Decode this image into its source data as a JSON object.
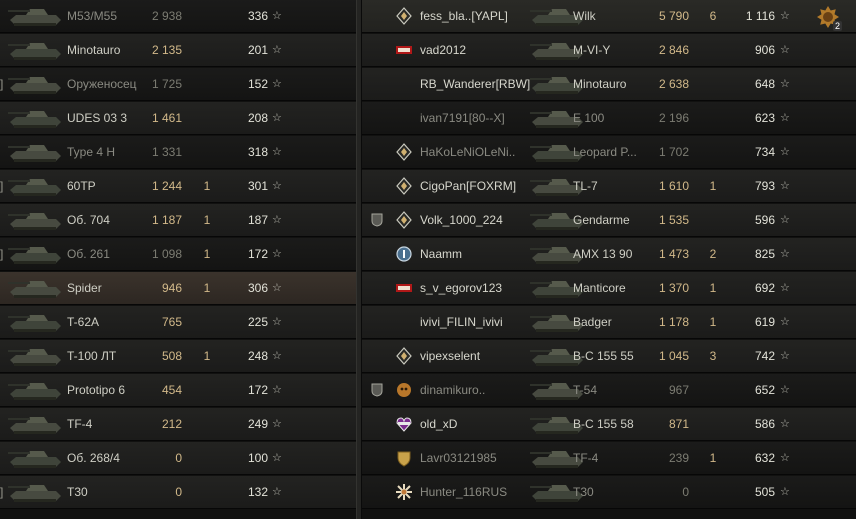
{
  "left_team": [
    {
      "clip": "",
      "tank": "M53/M55",
      "damage": "2 938",
      "frags": "",
      "xp": "336",
      "dead": true
    },
    {
      "clip": "",
      "tank": "Minotauro",
      "damage": "2 135",
      "frags": "",
      "xp": "201",
      "dead": false
    },
    {
      "clip": "]",
      "tank": "Оруженосец",
      "damage": "1 725",
      "frags": "",
      "xp": "152",
      "dead": true
    },
    {
      "clip": "",
      "tank": "UDES 03 3",
      "damage": "1 461",
      "frags": "",
      "xp": "208",
      "dead": false
    },
    {
      "clip": "",
      "tank": "Type 4 H",
      "damage": "1 331",
      "frags": "",
      "xp": "318",
      "dead": true
    },
    {
      "clip": "]",
      "tank": "60TP",
      "damage": "1 244",
      "frags": "1",
      "xp": "301",
      "dead": false
    },
    {
      "clip": "",
      "tank": "Об. 704",
      "damage": "1 187",
      "frags": "1",
      "xp": "187",
      "dead": false
    },
    {
      "clip": "]",
      "tank": "Об. 261",
      "damage": "1 098",
      "frags": "1",
      "xp": "172",
      "dead": true
    },
    {
      "clip": "",
      "tank": "Spider",
      "damage": "946",
      "frags": "1",
      "xp": "306",
      "dead": false,
      "self": true
    },
    {
      "clip": "",
      "tank": "T-62A",
      "damage": "765",
      "frags": "",
      "xp": "225",
      "dead": false
    },
    {
      "clip": "",
      "tank": "T-100 ЛТ",
      "damage": "508",
      "frags": "1",
      "xp": "248",
      "dead": false
    },
    {
      "clip": "",
      "tank": "Prototipo 6",
      "damage": "454",
      "frags": "",
      "xp": "172",
      "dead": false
    },
    {
      "clip": "",
      "tank": "TF-4",
      "damage": "212",
      "frags": "",
      "xp": "249",
      "dead": false
    },
    {
      "clip": "",
      "tank": "Об. 268/4",
      "damage": "0",
      "frags": "",
      "xp": "100",
      "dead": false
    },
    {
      "clip": "]",
      "tank": "T30",
      "damage": "0",
      "frags": "",
      "xp": "132",
      "dead": false
    }
  ],
  "right_team": [
    {
      "player": "fess_bla..[YAPL]",
      "badge": "rank-diamond-icon",
      "tank": "Wilk",
      "damage": "5 790",
      "frags": "6",
      "xp": "1 116",
      "dead": false,
      "platoon": false,
      "medal_count": "2"
    },
    {
      "player": "vad2012",
      "badge": "80-ribbon-icon",
      "tank": "M-VI-Y",
      "damage": "2 846",
      "frags": "",
      "xp": "906",
      "dead": false,
      "platoon": false
    },
    {
      "player": "RB_Wanderer[RBW]",
      "badge": "",
      "tank": "Minotauro",
      "damage": "2 638",
      "frags": "",
      "xp": "648",
      "dead": false,
      "platoon": false
    },
    {
      "player": "ivan7191[80--X]",
      "badge": "",
      "tank": "E 100",
      "damage": "2 196",
      "frags": "",
      "xp": "623",
      "dead": true,
      "platoon": false
    },
    {
      "player": "HaKoLeNiOLeNi..",
      "badge": "rank-diamond-icon",
      "tank": "Leopard P...",
      "damage": "1 702",
      "frags": "",
      "xp": "734",
      "dead": true,
      "platoon": false
    },
    {
      "player": "CigoPan[FOXRM]",
      "badge": "rank-diamond-icon",
      "tank": "TL-7",
      "damage": "1 610",
      "frags": "1",
      "xp": "793",
      "dead": false,
      "platoon": false
    },
    {
      "player": "Volk_1000_224",
      "badge": "rank-diamond-icon",
      "tank": "Gendarme",
      "damage": "1 535",
      "frags": "",
      "xp": "596",
      "dead": false,
      "platoon": true
    },
    {
      "player": "Naamm",
      "badge": "round-badge-icon",
      "tank": "AMX 13 90",
      "damage": "1 473",
      "frags": "2",
      "xp": "825",
      "dead": false,
      "platoon": false
    },
    {
      "player": "s_v_egorov123",
      "badge": "80-ribbon-icon",
      "tank": "Manticore",
      "damage": "1 370",
      "frags": "1",
      "xp": "692",
      "dead": false,
      "platoon": false
    },
    {
      "player": "ivivi_FILIN_ivivi",
      "badge": "",
      "tank": "Badger",
      "damage": "1 178",
      "frags": "1",
      "xp": "619",
      "dead": false,
      "platoon": false
    },
    {
      "player": "vipexselent",
      "badge": "rank-diamond-icon",
      "tank": "B-C 155 55",
      "damage": "1 045",
      "frags": "3",
      "xp": "742",
      "dead": false,
      "platoon": false
    },
    {
      "player": "dinamikuro..",
      "badge": "beast-emblem-icon",
      "tank": "T-54",
      "damage": "967",
      "frags": "",
      "xp": "652",
      "dead": true,
      "platoon": true
    },
    {
      "player": "old_xD",
      "badge": "love-heart-icon",
      "tank": "B-C 155 58",
      "damage": "871",
      "frags": "",
      "xp": "586",
      "dead": false,
      "platoon": false
    },
    {
      "player": "Lavr03121985",
      "badge": "gold-shield-icon",
      "tank": "TF-4",
      "damage": "239",
      "frags": "1",
      "xp": "632",
      "dead": true,
      "platoon": false
    },
    {
      "player": "Hunter_116RUS",
      "badge": "snowflake-icon",
      "tank": "T30",
      "damage": "0",
      "frags": "",
      "xp": "505",
      "dead": true,
      "platoon": false
    }
  ],
  "star_glyph": "☆",
  "platoon_glyph": "I",
  "colors": {
    "damage": "#d2b98a",
    "xp": "#e2e2d8",
    "text": "#cfcfc5",
    "dead_text": "#8a8a82",
    "self_row": "#3b332c"
  }
}
